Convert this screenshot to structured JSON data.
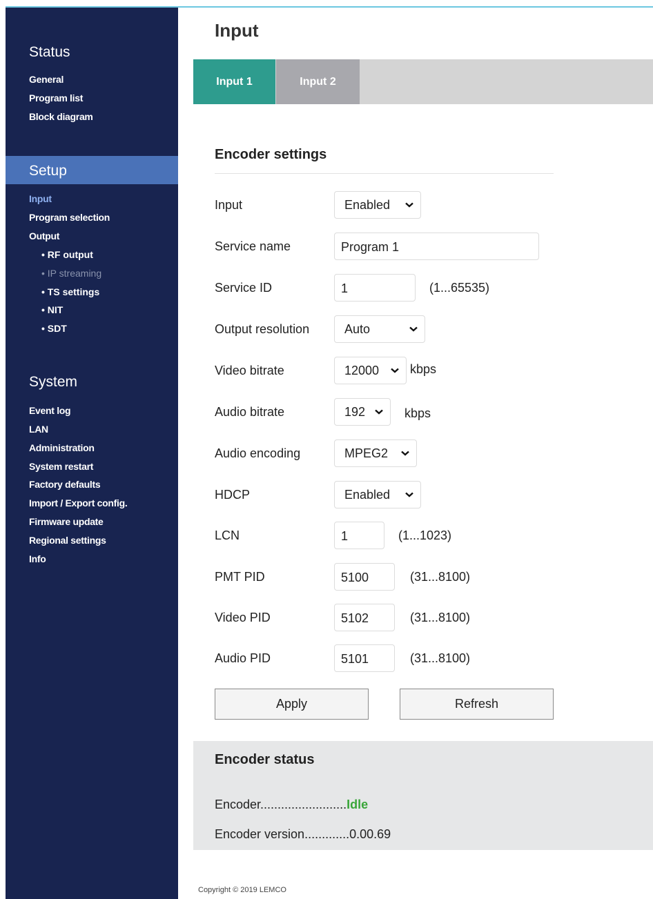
{
  "sidebar": {
    "status_heading": "Status",
    "status_items": [
      "General",
      "Program list",
      "Block diagram"
    ],
    "setup_heading": "Setup",
    "setup_items": {
      "input": "Input",
      "program_selection": "Program selection",
      "output": "Output",
      "rf_output": "RF output",
      "ip_streaming": "IP streaming",
      "ts_settings": "TS settings",
      "nit": "NIT",
      "sdt": "SDT"
    },
    "system_heading": "System",
    "system_items": [
      "Event log",
      "LAN",
      "Administration",
      "System restart",
      "Factory defaults",
      "Import / Export config.",
      "Firmware update",
      "Regional settings",
      "Info"
    ],
    "bullet": "•"
  },
  "main": {
    "title": "Input",
    "tabs": [
      "Input 1",
      "Input 2"
    ],
    "section_title": "Encoder settings",
    "fields": {
      "input": {
        "label": "Input",
        "value": "Enabled"
      },
      "service_name": {
        "label": "Service name",
        "value": "Program 1"
      },
      "service_id": {
        "label": "Service ID",
        "value": "1",
        "range": "(1...65535)"
      },
      "output_resolution": {
        "label": "Output resolution",
        "value": "Auto"
      },
      "video_bitrate": {
        "label": "Video bitrate",
        "value": "12000",
        "unit": "kbps"
      },
      "audio_bitrate": {
        "label": "Audio bitrate",
        "value": "192",
        "unit": "kbps"
      },
      "audio_encoding": {
        "label": "Audio encoding",
        "value": "MPEG2"
      },
      "hdcp": {
        "label": "HDCP",
        "value": "Enabled"
      },
      "lcn": {
        "label": "LCN",
        "value": "1",
        "range": "(1...1023)"
      },
      "pmt_pid": {
        "label": "PMT PID",
        "value": "5100",
        "range": "(31...8100)"
      },
      "video_pid": {
        "label": "Video PID",
        "value": "5102",
        "range": "(31...8100)"
      },
      "audio_pid": {
        "label": "Audio PID",
        "value": "5101",
        "range": "(31...8100)"
      }
    },
    "buttons": {
      "apply": "Apply",
      "refresh": "Refresh"
    },
    "encoder_status": {
      "title": "Encoder status",
      "encoder_label": "Encoder.........................",
      "encoder_value": "Idle",
      "version_label": "Encoder version.............",
      "version_value": "0.00.69"
    },
    "copyright": "Copyright © 2019 LEMCO"
  },
  "colors": {
    "sidebar_bg": "#182450",
    "setup_band": "#4a72b8",
    "tab_active": "#2e9c8e",
    "tab_inactive": "#a8a8ad",
    "status_idle": "#3aa63a",
    "top_accent": "#6cc7e0"
  },
  "icons": {
    "dropdown": "chevron-down-icon"
  }
}
